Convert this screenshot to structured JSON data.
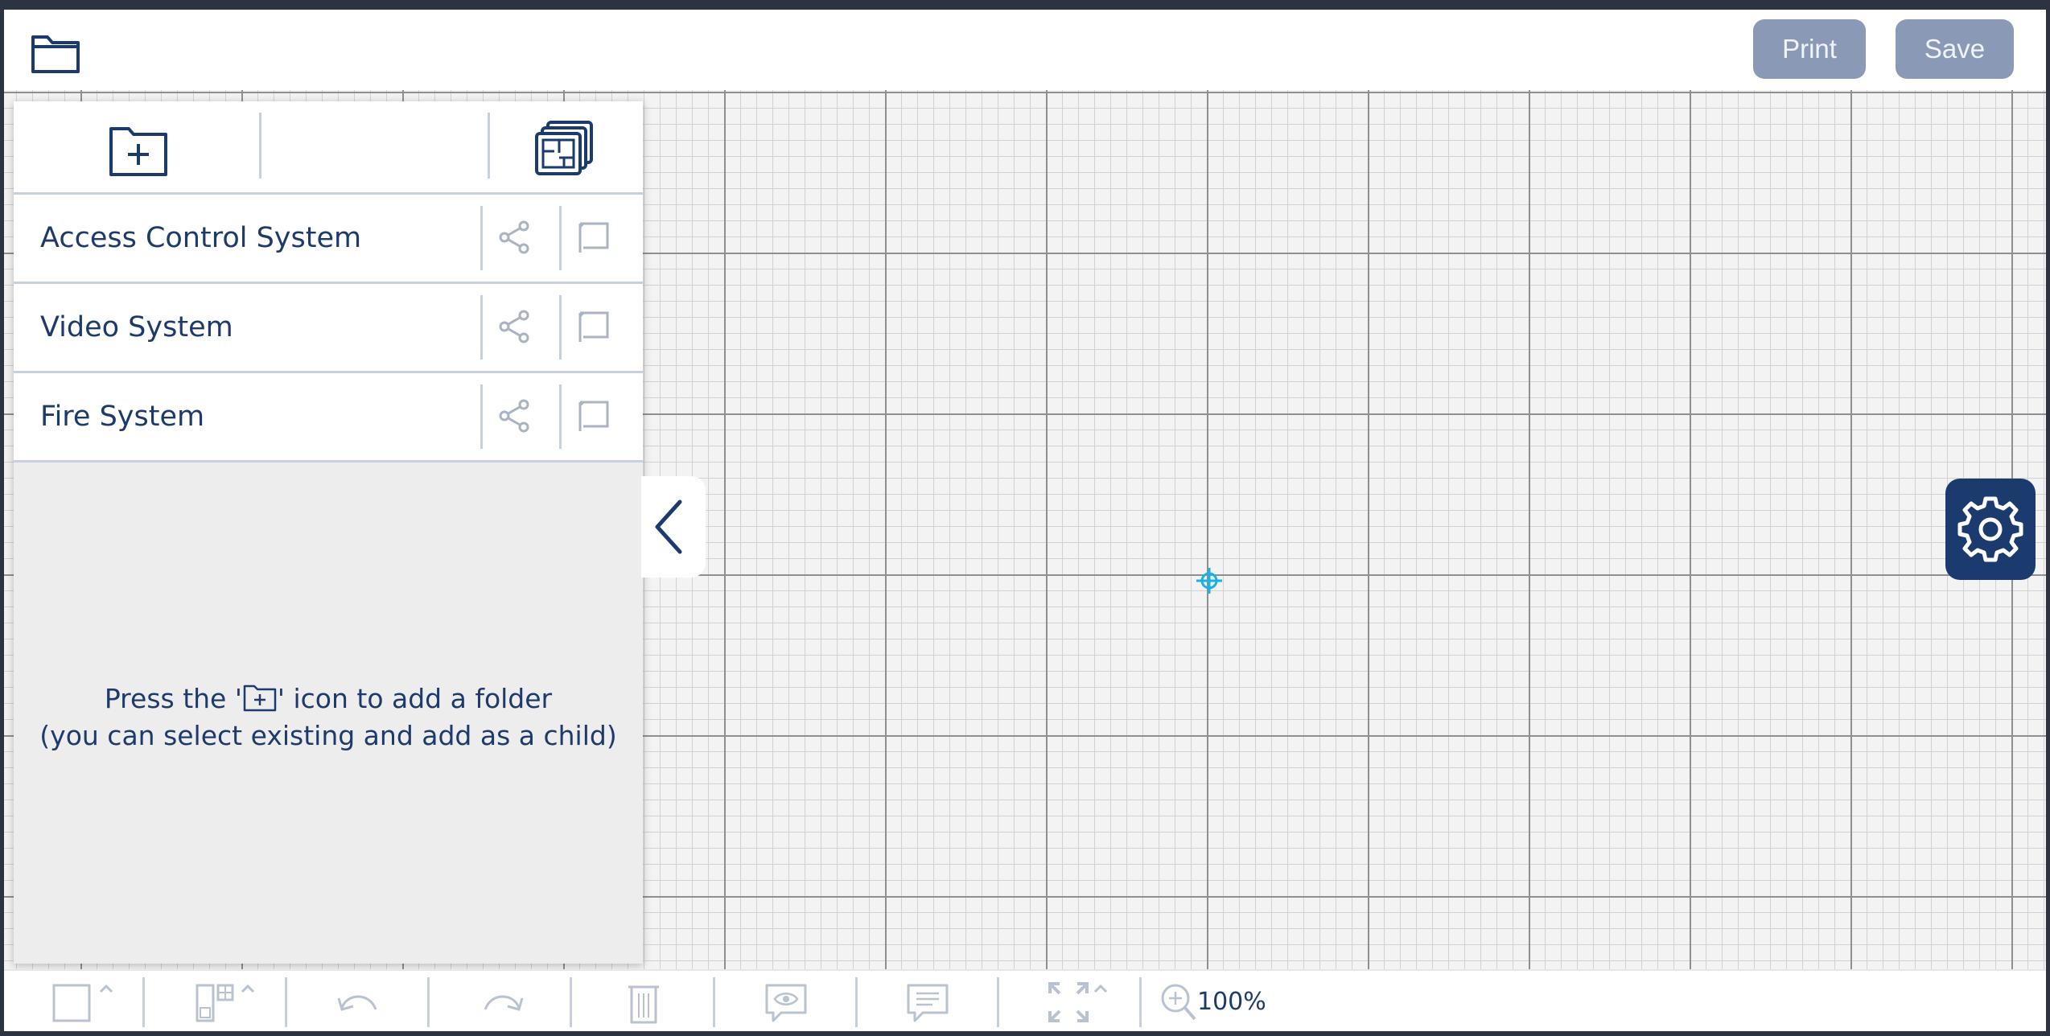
{
  "header": {
    "folder_icon": "folder-icon",
    "print_label": "Print",
    "save_label": "Save"
  },
  "panel": {
    "toolbar": {
      "add_folder_icon": "folder-plus-icon",
      "floor_plans_icon": "floor-plans-icon"
    },
    "folders": [
      {
        "label": "Access Control System"
      },
      {
        "label": "Video System"
      },
      {
        "label": "Fire System"
      }
    ],
    "hint": {
      "line1_before": "Press the '",
      "line1_after": "' icon to add a folder",
      "line2": "(you can select existing and add as a child)"
    }
  },
  "bottom_toolbar": {
    "zoom": "100%",
    "tools": [
      "shape-icon",
      "devices-icon",
      "undo-icon",
      "redo-icon",
      "trash-icon",
      "preview-icon",
      "comment-icon",
      "fit-screen-icon",
      "zoom-icon"
    ]
  },
  "colors": {
    "primary": "#1b3b6f",
    "button_disabled": "#8a9ab6",
    "crosshair": "#1ab0e8",
    "grid_major": "#8f8f91",
    "grid_minor": "#d2d2d4"
  }
}
